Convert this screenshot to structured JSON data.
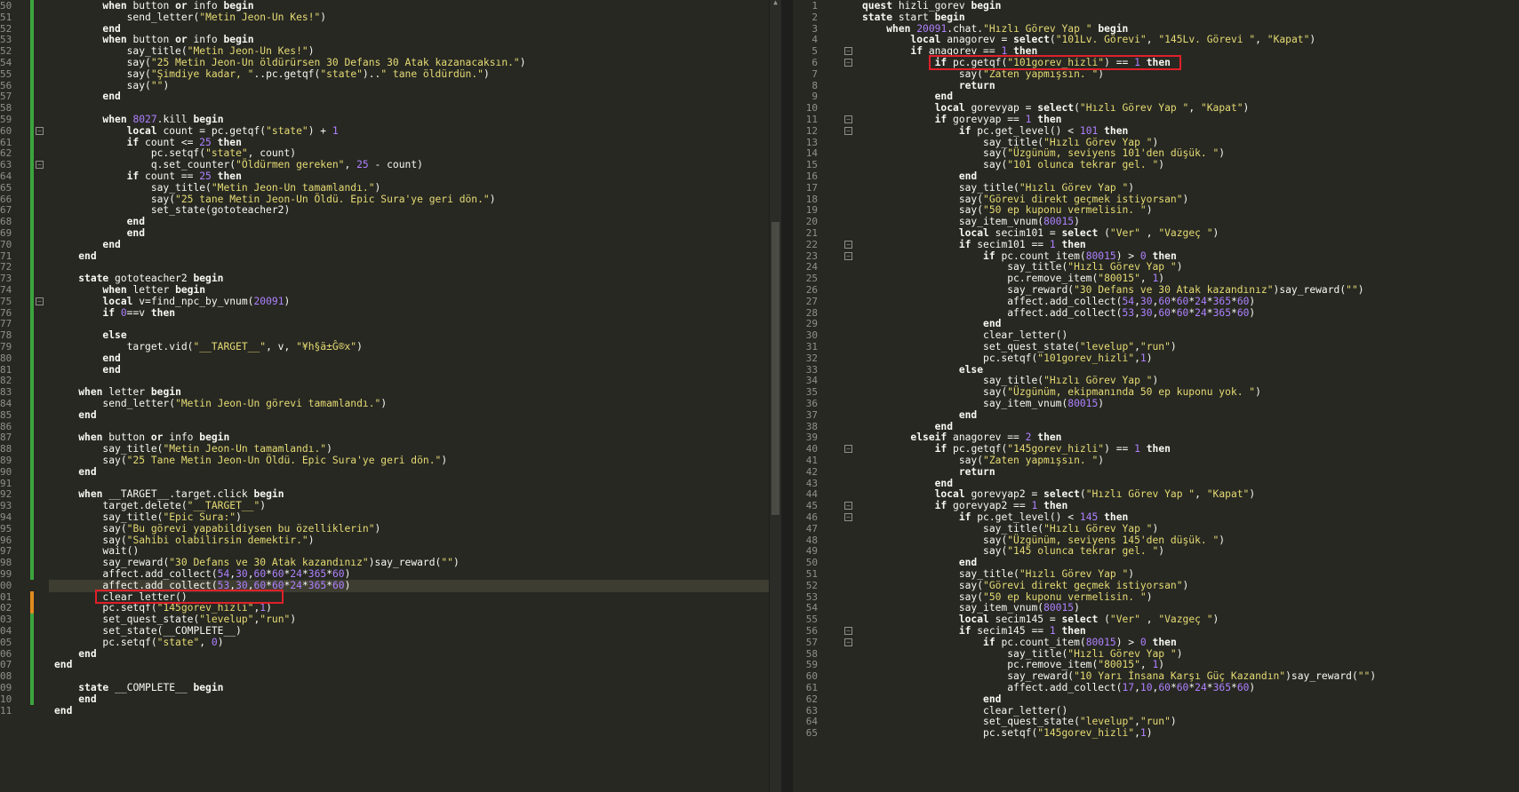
{
  "left": {
    "lines": [
      {
        "n": "50",
        "t": "        when button or info begin"
      },
      {
        "n": "51",
        "t": "            send_letter(\"Metin Jeon-Un Kes!\")"
      },
      {
        "n": "52",
        "t": "        end"
      },
      {
        "n": "53",
        "t": "        when button or info begin"
      },
      {
        "n": "52",
        "t": "            say_title(\"Metin Jeon-Un Kes!\")"
      },
      {
        "n": "54",
        "t": "            say(\"25 Metin Jeon-Un öldürürsen 30 Defans 30 Atak kazanacaksın.\")"
      },
      {
        "n": "55",
        "t": "            say(\"Şimdiye kadar, \"..pc.getqf(\"state\")..\" tane öldürdün.\")"
      },
      {
        "n": "56",
        "t": "            say(\"\")"
      },
      {
        "n": "57",
        "t": "        end"
      },
      {
        "n": "58",
        "t": ""
      },
      {
        "n": "59",
        "t": "        when 8027.kill begin"
      },
      {
        "n": "60",
        "t": "            local count = pc.getqf(\"state\") + 1"
      },
      {
        "n": "61",
        "t": "            if count <= 25 then"
      },
      {
        "n": "62",
        "t": "                pc.setqf(\"state\", count)"
      },
      {
        "n": "63",
        "t": "                q.set_counter(\"Öldürmen gereken\", 25 - count)"
      },
      {
        "n": "64",
        "t": "            if count == 25 then"
      },
      {
        "n": "65",
        "t": "                say_title(\"Metin Jeon-Un tamamlandı.\")"
      },
      {
        "n": "66",
        "t": "                say(\"25 tane Metin Jeon-Un Öldü. Epic Sura'ye geri dön.\")"
      },
      {
        "n": "67",
        "t": "                set_state(gototeacher2)"
      },
      {
        "n": "68",
        "t": "            end"
      },
      {
        "n": "69",
        "t": "            end"
      },
      {
        "n": "70",
        "t": "        end"
      },
      {
        "n": "71",
        "t": "    end"
      },
      {
        "n": "72",
        "t": ""
      },
      {
        "n": "73",
        "t": "    state gototeacher2 begin"
      },
      {
        "n": "74",
        "t": "        when letter begin"
      },
      {
        "n": "75",
        "t": "        local v=find_npc_by_vnum(20091)"
      },
      {
        "n": "76",
        "t": "        if 0==v then"
      },
      {
        "n": "77",
        "t": "            "
      },
      {
        "n": "78",
        "t": "        else"
      },
      {
        "n": "79",
        "t": "            target.vid(\"__TARGET__\", v, \"¥h§ä±Ĝ®x\")"
      },
      {
        "n": "80",
        "t": "        end"
      },
      {
        "n": "81",
        "t": "        end"
      },
      {
        "n": "82",
        "t": ""
      },
      {
        "n": "83",
        "t": "    when letter begin"
      },
      {
        "n": "84",
        "t": "        send_letter(\"Metin Jeon-Un görevi tamamlandı.\")"
      },
      {
        "n": "85",
        "t": "    end"
      },
      {
        "n": "86",
        "t": ""
      },
      {
        "n": "87",
        "t": "    when button or info begin"
      },
      {
        "n": "88",
        "t": "        say_title(\"Metin Jeon-Un tamamlandı.\")"
      },
      {
        "n": "89",
        "t": "        say(\"25 Tane Metin Jeon-Un Öldü. Epic Sura'ye geri dön.\")"
      },
      {
        "n": "90",
        "t": "    end"
      },
      {
        "n": "91",
        "t": ""
      },
      {
        "n": "92",
        "t": "    when __TARGET__.target.click begin"
      },
      {
        "n": "93",
        "t": "        target.delete(\"__TARGET__\")"
      },
      {
        "n": "94",
        "t": "        say_title(\"Epic Sura:\")"
      },
      {
        "n": "95",
        "t": "        say(\"Bu görevi yapabildiysen bu özelliklerin\")"
      },
      {
        "n": "96",
        "t": "        say(\"Sahibi olabilirsin demektir.\")"
      },
      {
        "n": "97",
        "t": "        wait()"
      },
      {
        "n": "98",
        "t": "        say_reward(\"30 Defans ve 30 Atak kazandınız\")say_reward(\"\")"
      },
      {
        "n": "99",
        "t": "        affect.add_collect(54,30,60*60*24*365*60)"
      },
      {
        "n": "00",
        "t": "        affect.add_collect(53,30,60*60*24*365*60)"
      },
      {
        "n": "01",
        "t": "        clear_letter()"
      },
      {
        "n": "02",
        "t": "        pc.setqf(\"145gorev_hizli\",1)"
      },
      {
        "n": "03",
        "t": "        set_quest_state(\"levelup\",\"run\")"
      },
      {
        "n": "04",
        "t": "        set_state(__COMPLETE__)"
      },
      {
        "n": "05",
        "t": "        pc.setqf(\"state\", 0)"
      },
      {
        "n": "06",
        "t": "    end"
      },
      {
        "n": "07",
        "t": "end"
      },
      {
        "n": "08",
        "t": ""
      },
      {
        "n": "09",
        "t": "    state __COMPLETE__ begin"
      },
      {
        "n": "10",
        "t": "    end"
      },
      {
        "n": "11",
        "t": "end"
      }
    ]
  },
  "right": {
    "lines": [
      {
        "n": "1",
        "t": "quest hizli_gorev begin"
      },
      {
        "n": "2",
        "t": "state start begin"
      },
      {
        "n": "3",
        "t": "    when 20091.chat.\"Hızlı Görev Yap \" begin"
      },
      {
        "n": "4",
        "t": "        local anagorev = select(\"101Lv. Görevi\", \"145Lv. Görevi \", \"Kapat\")"
      },
      {
        "n": "5",
        "t": "        if anagorev == 1 then"
      },
      {
        "n": "6",
        "t": "            if pc.getqf(\"101gorev_hizli\") == 1 then"
      },
      {
        "n": "7",
        "t": "                say(\"Zaten yapmışsın. \")"
      },
      {
        "n": "8",
        "t": "                return"
      },
      {
        "n": "9",
        "t": "            end"
      },
      {
        "n": "10",
        "t": "            local gorevyap = select(\"Hızlı Görev Yap \", \"Kapat\")"
      },
      {
        "n": "11",
        "t": "            if gorevyap == 1 then"
      },
      {
        "n": "12",
        "t": "                if pc.get_level() < 101 then"
      },
      {
        "n": "13",
        "t": "                    say_title(\"Hızlı Görev Yap \")"
      },
      {
        "n": "14",
        "t": "                    say(\"Üzgünüm, seviyens 101'den düşük. \")"
      },
      {
        "n": "15",
        "t": "                    say(\"101 olunca tekrar gel. \")"
      },
      {
        "n": "16",
        "t": "                end"
      },
      {
        "n": "17",
        "t": "                say_title(\"Hızlı Görev Yap \")"
      },
      {
        "n": "18",
        "t": "                say(\"Görevi direkt geçmek istiyorsan\")"
      },
      {
        "n": "19",
        "t": "                say(\"50 ep kuponu vermelisin. \")"
      },
      {
        "n": "20",
        "t": "                say_item_vnum(80015)"
      },
      {
        "n": "21",
        "t": "                local secim101 = select (\"Ver\" , \"Vazgeç \")"
      },
      {
        "n": "22",
        "t": "                if secim101 == 1 then"
      },
      {
        "n": "23",
        "t": "                    if pc.count_item(80015) > 0 then"
      },
      {
        "n": "24",
        "t": "                        say_title(\"Hızlı Görev Yap \")"
      },
      {
        "n": "25",
        "t": "                        pc.remove_item(\"80015\", 1)"
      },
      {
        "n": "26",
        "t": "                        say_reward(\"30 Defans ve 30 Atak kazandınız\")say_reward(\"\")"
      },
      {
        "n": "27",
        "t": "                        affect.add_collect(54,30,60*60*24*365*60)"
      },
      {
        "n": "28",
        "t": "                        affect.add_collect(53,30,60*60*24*365*60)"
      },
      {
        "n": "29",
        "t": "                    end"
      },
      {
        "n": "30",
        "t": "                    clear_letter()"
      },
      {
        "n": "31",
        "t": "                    set_quest_state(\"levelup\",\"run\")"
      },
      {
        "n": "32",
        "t": "                    pc.setqf(\"101gorev_hizli\",1)"
      },
      {
        "n": "33",
        "t": "                else"
      },
      {
        "n": "34",
        "t": "                    say_title(\"Hızlı Görev Yap \")"
      },
      {
        "n": "35",
        "t": "                    say(\"Üzgünüm, ekipmanında 50 ep kuponu yok. \")"
      },
      {
        "n": "36",
        "t": "                    say_item_vnum(80015)"
      },
      {
        "n": "37",
        "t": "                end"
      },
      {
        "n": "38",
        "t": "            end"
      },
      {
        "n": "39",
        "t": "        elseif anagorev == 2 then"
      },
      {
        "n": "40",
        "t": "            if pc.getqf(\"145gorev_hizli\") == 1 then"
      },
      {
        "n": "41",
        "t": "                say(\"Zaten yapmışsın. \")"
      },
      {
        "n": "42",
        "t": "                return"
      },
      {
        "n": "43",
        "t": "            end"
      },
      {
        "n": "44",
        "t": "            local gorevyap2 = select(\"Hızlı Görev Yap \", \"Kapat\")"
      },
      {
        "n": "45",
        "t": "            if gorevyap2 == 1 then"
      },
      {
        "n": "46",
        "t": "                if pc.get_level() < 145 then"
      },
      {
        "n": "47",
        "t": "                    say_title(\"Hızlı Görev Yap \")"
      },
      {
        "n": "48",
        "t": "                    say(\"Üzgünüm, seviyens 145'den düşük. \")"
      },
      {
        "n": "49",
        "t": "                    say(\"145 olunca tekrar gel. \")"
      },
      {
        "n": "50",
        "t": "                end"
      },
      {
        "n": "51",
        "t": "                say_title(\"Hızlı Görev Yap \")"
      },
      {
        "n": "52",
        "t": "                say(\"Görevi direkt geçmek istiyorsan\")"
      },
      {
        "n": "53",
        "t": "                say(\"50 ep kuponu vermelisin. \")"
      },
      {
        "n": "54",
        "t": "                say_item_vnum(80015)"
      },
      {
        "n": "55",
        "t": "                local secim145 = select (\"Ver\" , \"Vazgeç \")"
      },
      {
        "n": "56",
        "t": "                if secim145 == 1 then"
      },
      {
        "n": "57",
        "t": "                    if pc.count_item(80015) > 0 then"
      },
      {
        "n": "58",
        "t": "                        say_title(\"Hızlı Görev Yap \")"
      },
      {
        "n": "59",
        "t": "                        pc.remove_item(\"80015\", 1)"
      },
      {
        "n": "60",
        "t": "                        say_reward(\"10 Yarı İnsana Karşı Güç Kazandın\")say_reward(\"\")"
      },
      {
        "n": "61",
        "t": "                        affect.add_collect(17,10,60*60*24*365*60)"
      },
      {
        "n": "62",
        "t": "                    end"
      },
      {
        "n": "63",
        "t": "                    clear_letter()"
      },
      {
        "n": "64",
        "t": "                    set_quest_state(\"levelup\",\"run\")"
      },
      {
        "n": "65",
        "t": "                    pc.setqf(\"145gorev_hizli\",1)"
      }
    ]
  },
  "colors": {
    "background": "#272822",
    "current_line": "#3e3d32",
    "highlight_box": "#e0202a",
    "change_bar_saved": "#3ca33c",
    "change_bar_modified": "#e08a1e"
  }
}
